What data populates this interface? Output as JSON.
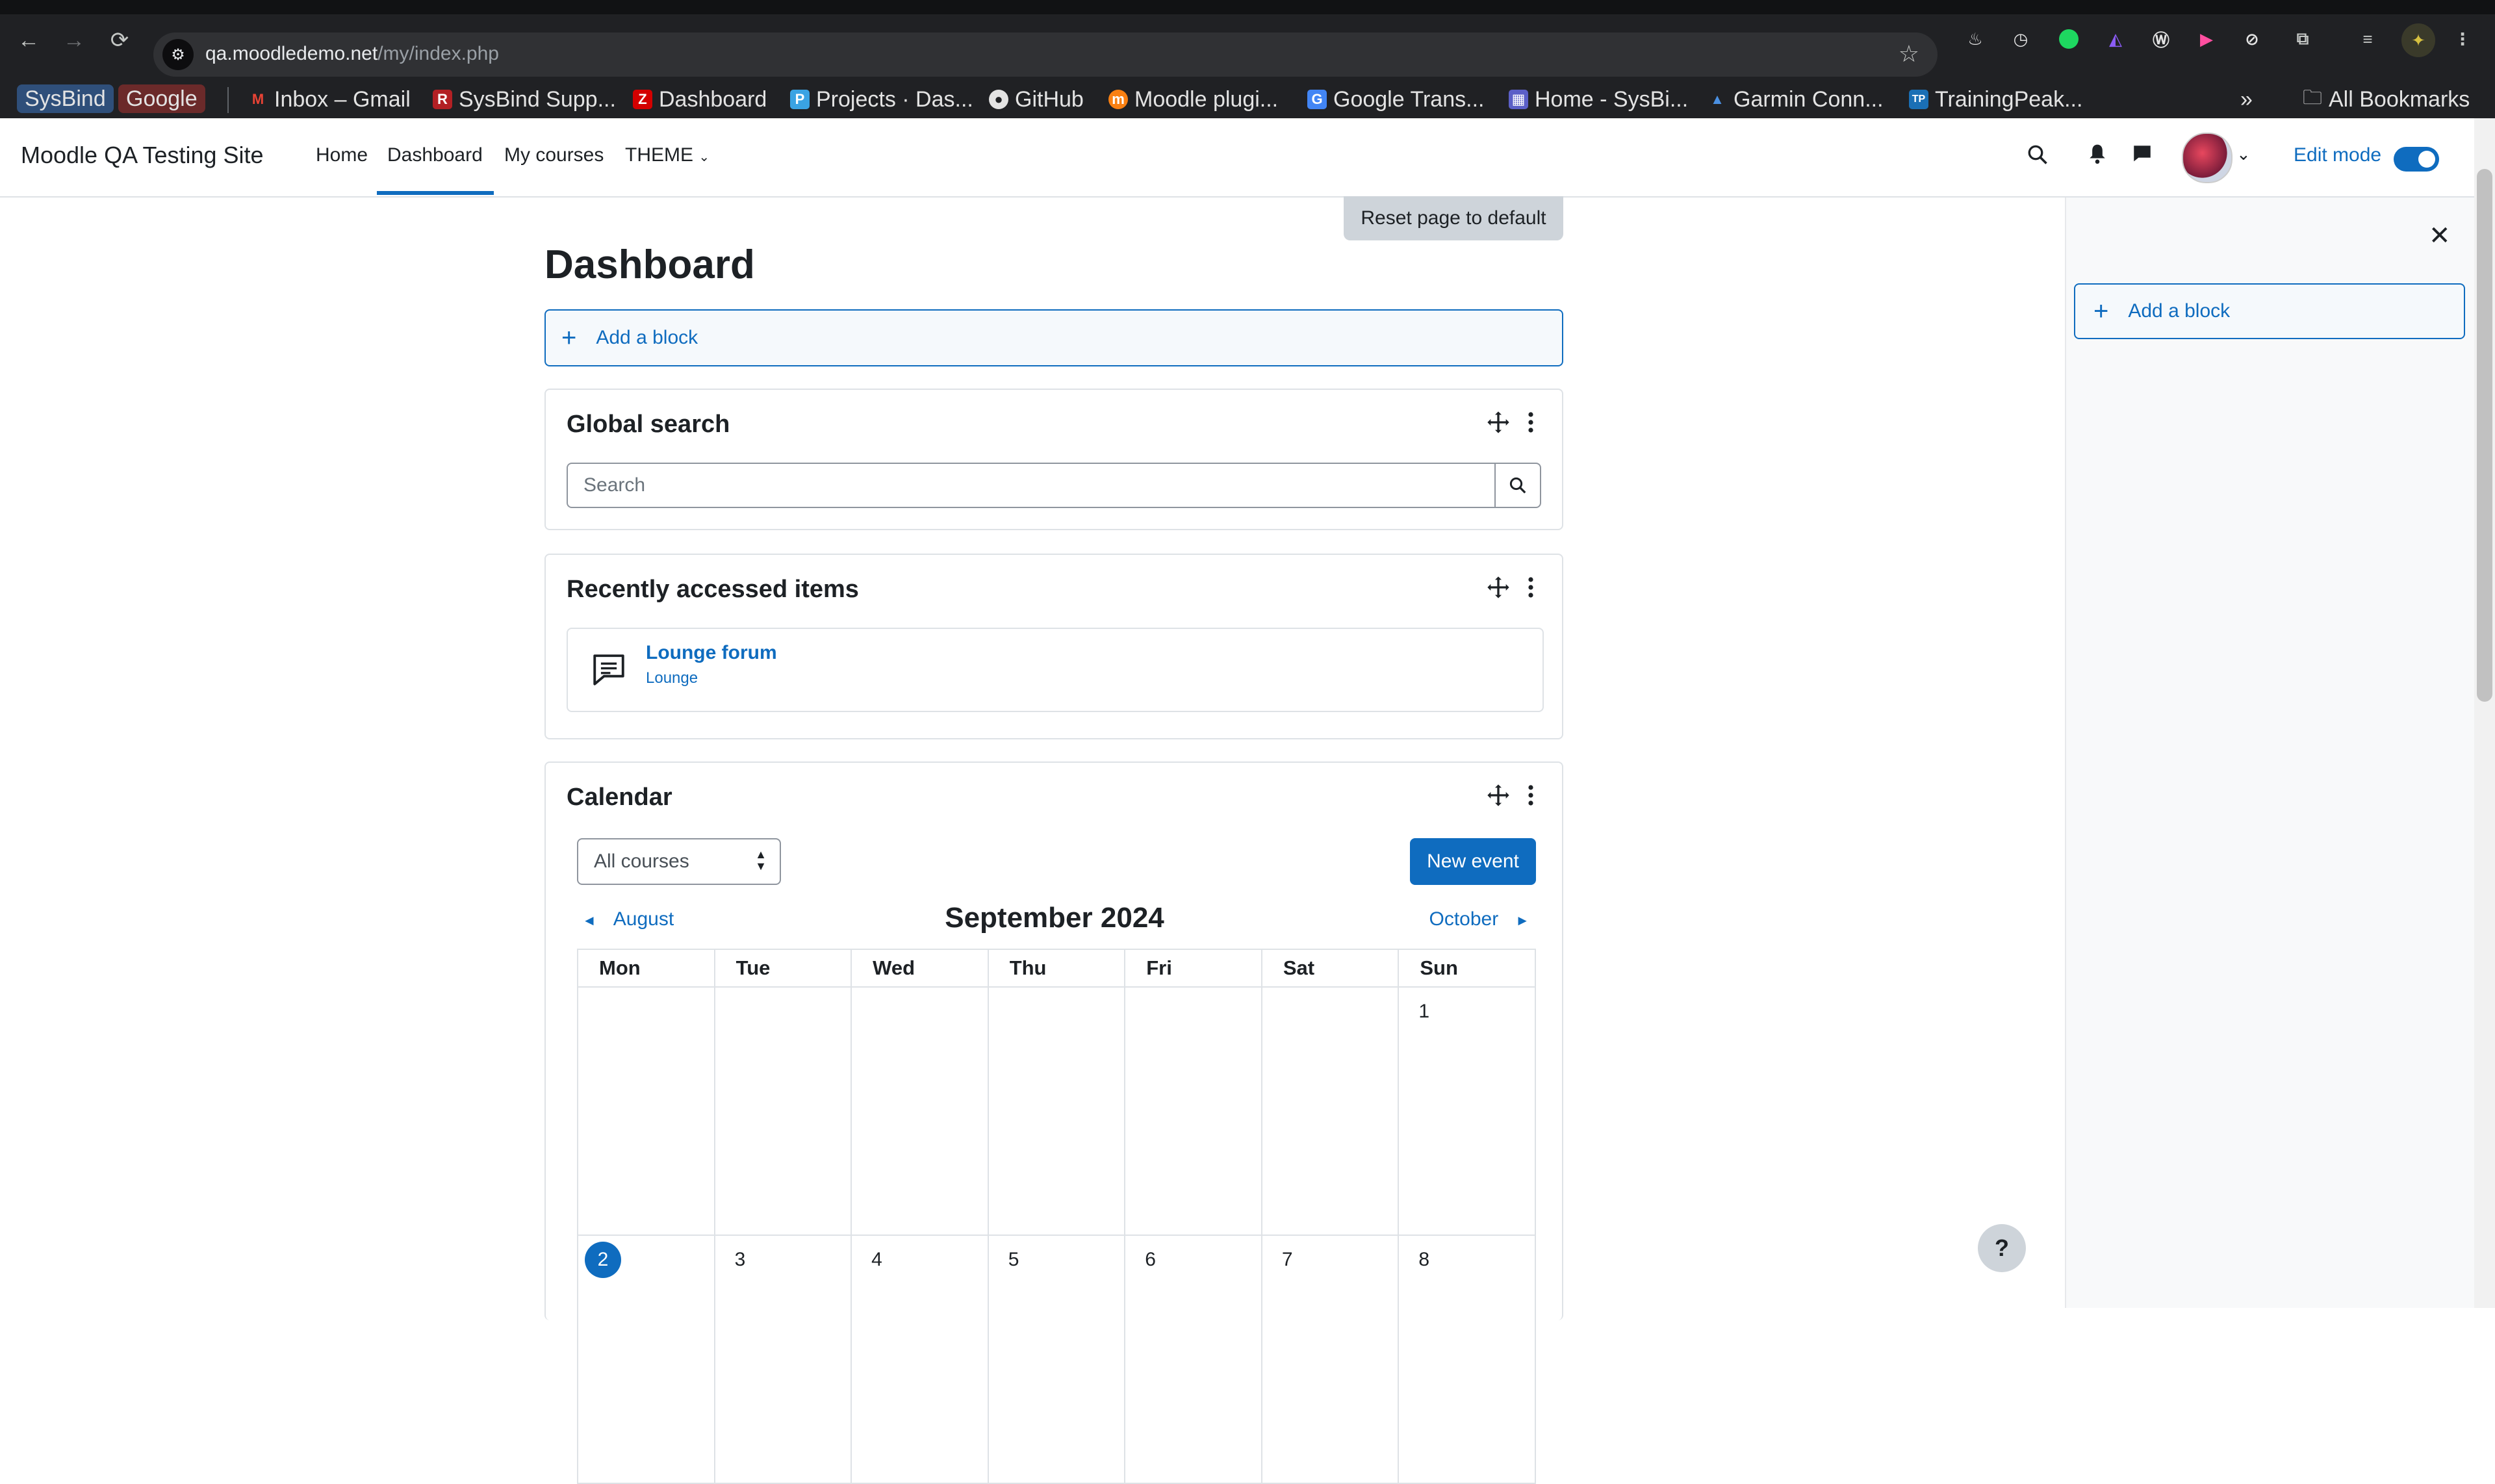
{
  "browser": {
    "url_host": "qa.moodledemo.net",
    "url_path": "/my/index.php",
    "bookmarks": [
      {
        "label": "Inbox – Gmail",
        "icon": "gmail-icon",
        "color": "#ea4335",
        "glyph": "M"
      },
      {
        "label": "SysBind Supp...",
        "icon": "redmine-icon",
        "color": "#b32024",
        "glyph": "R"
      },
      {
        "label": "Dashboard",
        "icon": "zabbix-icon",
        "color": "#d40000",
        "glyph": "Z"
      },
      {
        "label": "Projects · Das...",
        "icon": "pocket-icon",
        "color": "#3aa3e3",
        "glyph": "P"
      },
      {
        "label": "GitHub",
        "icon": "github-icon",
        "color": "#333333",
        "glyph": "●"
      },
      {
        "label": "Moodle plugi...",
        "icon": "moodle-icon",
        "color": "#f98012",
        "glyph": "m"
      },
      {
        "label": "Google Trans...",
        "icon": "google-translate-icon",
        "color": "#4285f4",
        "glyph": "G"
      },
      {
        "label": "Home - SysBi...",
        "icon": "grid-icon",
        "color": "#5b5fc7",
        "glyph": "▦"
      },
      {
        "label": "Garmin Conn...",
        "icon": "garmin-icon",
        "color": "#1a73e8",
        "glyph": "▲"
      },
      {
        "label": "TrainingPeak...",
        "icon": "trainingpeaks-icon",
        "color": "#1a6fb5",
        "glyph": "TP"
      }
    ],
    "chips": [
      "SysBind",
      "Google"
    ],
    "all_bookmarks": "All Bookmarks"
  },
  "navbar": {
    "site_name": "Moodle QA Testing Site",
    "links": [
      "Home",
      "Dashboard",
      "My courses",
      "THEME"
    ],
    "edit_mode_label": "Edit mode",
    "edit_mode_on": true
  },
  "page": {
    "reset_label": "Reset page to default",
    "title": "Dashboard",
    "add_block_label": "Add a block"
  },
  "global_search": {
    "title": "Global search",
    "placeholder": "Search"
  },
  "recent": {
    "title": "Recently accessed items",
    "items": [
      {
        "name": "Lounge forum",
        "course": "Lounge"
      }
    ]
  },
  "calendar": {
    "title": "Calendar",
    "course_filter": "All courses",
    "new_event_label": "New event",
    "prev_month": "August",
    "next_month": "October",
    "month": "September 2024",
    "weekdays": [
      "Mon",
      "Tue",
      "Wed",
      "Thu",
      "Fri",
      "Sat",
      "Sun"
    ],
    "weeks": [
      [
        "",
        "",
        "",
        "",
        "",
        "",
        "1"
      ],
      [
        "2",
        "3",
        "4",
        "5",
        "6",
        "7",
        "8"
      ]
    ],
    "today": "2"
  },
  "drawer": {
    "add_block_label": "Add a block"
  },
  "help_label": "?",
  "colors": {
    "brand": "#0f6cbf",
    "border": "#dee2e6",
    "drawer_bg": "#f8f9fa"
  }
}
